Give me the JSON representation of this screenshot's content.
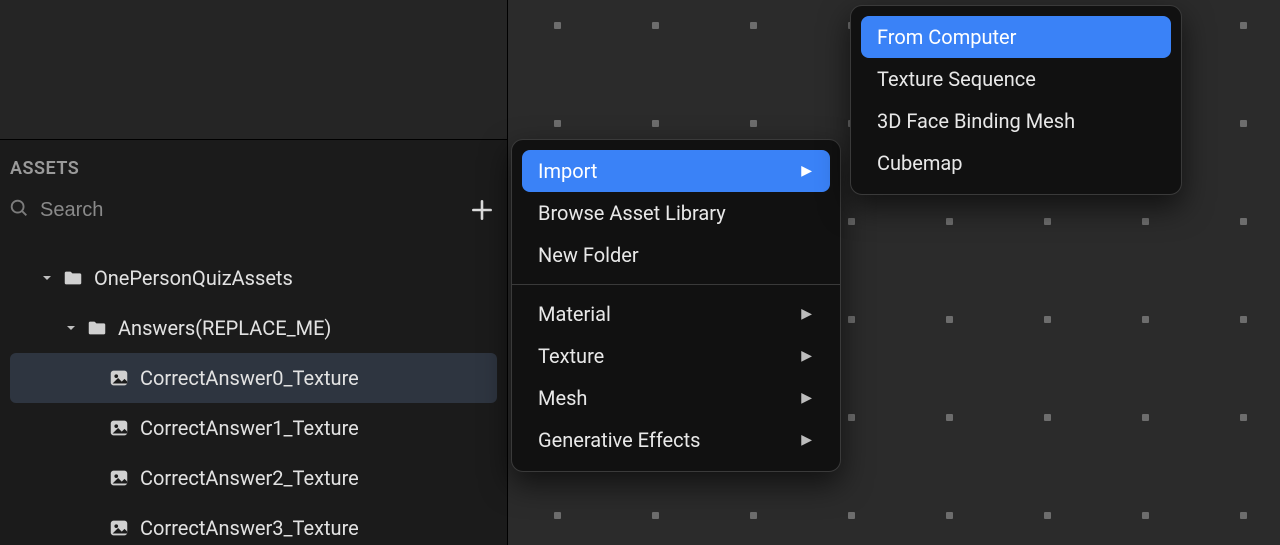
{
  "panel_label": "ASSETS",
  "search": {
    "placeholder": "Search",
    "value": ""
  },
  "tree": {
    "root": {
      "label": "OnePersonQuizAssets"
    },
    "folder": {
      "label": "Answers(REPLACE_ME)"
    },
    "items": [
      {
        "label": "CorrectAnswer0_Texture",
        "selected": true
      },
      {
        "label": "CorrectAnswer1_Texture",
        "selected": false
      },
      {
        "label": "CorrectAnswer2_Texture",
        "selected": false
      },
      {
        "label": "CorrectAnswer3_Texture",
        "selected": false
      }
    ]
  },
  "menu1": {
    "group1": [
      {
        "label": "Import",
        "submenu": true,
        "highlight": true
      },
      {
        "label": "Browse Asset Library",
        "submenu": false
      },
      {
        "label": "New Folder",
        "submenu": false
      }
    ],
    "group2": [
      {
        "label": "Material",
        "submenu": true
      },
      {
        "label": "Texture",
        "submenu": true
      },
      {
        "label": "Mesh",
        "submenu": true
      },
      {
        "label": "Generative Effects",
        "submenu": true
      }
    ]
  },
  "menu2": {
    "items": [
      {
        "label": "From Computer",
        "highlight": true
      },
      {
        "label": "Texture Sequence"
      },
      {
        "label": "3D Face Binding Mesh"
      },
      {
        "label": "Cubemap"
      }
    ]
  }
}
